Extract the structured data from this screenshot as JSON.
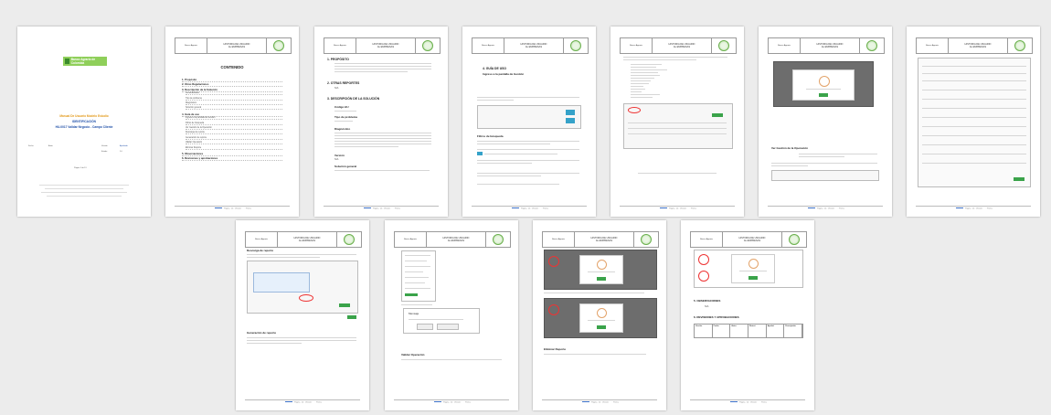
{
  "header": {
    "left": "Banco Agrario",
    "title_line1": "HISTORIA DE USUARIO",
    "title_line2": "AL EMPRESAS",
    "footer": "Página · de · Versión · · · · Fecha"
  },
  "cover": {
    "logo_text": "Banco Agrario de Colombia",
    "title_line1": "Manual De Usuario Modelo Estudio",
    "title_line2": "IDENTIFICACIÓN",
    "title_line3": "HU-0017 Validar Negocio - Campo Cliente",
    "meta_left": "Fecha",
    "meta_mid": "Autor",
    "meta_right1": "Versión",
    "meta_right2": "1.0",
    "meta_right3": "Estado",
    "meta_right4": "Aprobado",
    "page_label": "Página 1 de 13"
  },
  "contents": {
    "title": "CONTENIDO",
    "items": [
      "1. Propósito",
      "2. Otras Regulaciones",
      "3. Descripción de la Solución",
      "Generalidades",
      "Tipo de problema",
      "Diagnóstico",
      "Solución general",
      "4. Guía de uso",
      "Ingreso a la pantalla de Gestión",
      "Filtros de búsqueda",
      "Ver Gestión de la Operación",
      "Descarga de reporte",
      "Generación de reporte",
      "Validar Operación",
      "Eliminar Reporte",
      "5. Observaciones",
      "6. Revisiones y aprobaciones"
    ]
  },
  "page3": {
    "s1": "1. PROPÓSITO",
    "s2": "2. OTRAS REPORTES",
    "s2v": "N/A",
    "s3": "3. DESCRIPCIÓN DE LA SOLUCIÓN",
    "k1": "Código HU",
    "k2": "Tipo de problema",
    "k3": "Diagnóstico",
    "k4": "Versión",
    "k4v": "N/A",
    "k5": "Solución general"
  },
  "page4": {
    "s1": "4. GUÍA DE USO",
    "s1sub": "Ingreso a la pantalla de Gestión",
    "s2": "Filtros de búsqueda"
  },
  "page6": {
    "s1": "Ver Gestión de la Operación"
  },
  "page8": {
    "s1": "Descarga de reporte",
    "s2": "Generación de reporte"
  },
  "page9": {
    "s1": "Validar Operación",
    "dialog": "Mensaje"
  },
  "page10": {
    "s1": "Eliminar Reporte"
  },
  "page11": {
    "s1": "5. OBSERVACIONES",
    "s1v": "N/A",
    "s2": "6. REVISIONES Y APROBACIONES",
    "cols": [
      "Versión",
      "Fecha",
      "Autor",
      "Revisó",
      "Aprobó",
      "Descripción"
    ]
  }
}
